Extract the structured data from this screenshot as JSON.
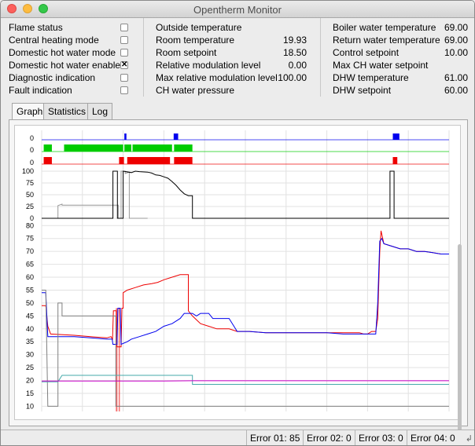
{
  "window": {
    "title": "Opentherm Monitor"
  },
  "status": {
    "flags": [
      {
        "label": "Flame status",
        "checked": false
      },
      {
        "label": "Central heating mode",
        "checked": false
      },
      {
        "label": "Domestic hot water mode",
        "checked": false
      },
      {
        "label": "Domestic hot water enable",
        "checked": true
      },
      {
        "label": "Diagnostic indication",
        "checked": false
      },
      {
        "label": "Fault indication",
        "checked": false
      }
    ],
    "middle": [
      {
        "label": "Outside temperature",
        "value": ""
      },
      {
        "label": "Room temperature",
        "value": "19.93"
      },
      {
        "label": "Room setpoint",
        "value": "18.50"
      },
      {
        "label": "Relative modulation level",
        "value": "0.00"
      },
      {
        "label": "Max relative modulation level",
        "value": "100.00"
      },
      {
        "label": "CH water pressure",
        "value": ""
      }
    ],
    "right": [
      {
        "label": "Boiler water temperature",
        "value": "69.00"
      },
      {
        "label": "Return water temperature",
        "value": "69.00"
      },
      {
        "label": "Control setpoint",
        "value": "10.00"
      },
      {
        "label": "Max CH water setpoint",
        "value": ""
      },
      {
        "label": "DHW temperature",
        "value": "61.00"
      },
      {
        "label": "DHW setpoint",
        "value": "60.00"
      }
    ]
  },
  "tabs": [
    {
      "label": "Graph",
      "active": true
    },
    {
      "label": "Statistics",
      "active": false
    },
    {
      "label": "Log",
      "active": false
    }
  ],
  "chart_data": {
    "type": "line",
    "x_range": [
      0,
      100
    ],
    "colors": {
      "flame": "#0000ee",
      "ch": "#00cc00",
      "dhw": "#ee0000",
      "modulation": "#000000",
      "boiler": "#ee0000",
      "return": "#0000ee",
      "control": "#808080",
      "room": "#cc00cc",
      "room_setpoint": "#44aaaa"
    },
    "digital": [
      {
        "name": "",
        "zero_label": "0",
        "color": "#0000ee",
        "pulses": [
          [
            20.3,
            20.8
          ],
          [
            32.4,
            33.5
          ],
          [
            86.2,
            87.8
          ]
        ]
      },
      {
        "name": "",
        "zero_label": "0",
        "color": "#00cc00",
        "pulses": [
          [
            0.5,
            2.5
          ],
          [
            5.5,
            20.0
          ],
          [
            20.3,
            22.0
          ],
          [
            22.3,
            32.0
          ],
          [
            32.5,
            37.0
          ]
        ]
      },
      {
        "name": "",
        "zero_label": "0",
        "color": "#ee0000",
        "pulses": [
          [
            0.5,
            2.5
          ],
          [
            19.0,
            20.2
          ],
          [
            21.0,
            31.5
          ],
          [
            32.5,
            37.0
          ],
          [
            86.2,
            87.3
          ]
        ]
      }
    ],
    "modulation": {
      "name": "",
      "y_ticks": [
        0,
        25,
        50,
        75,
        100
      ],
      "ylim": [
        0,
        100
      ],
      "grey": [
        [
          0,
          0
        ],
        [
          4,
          0
        ],
        [
          4,
          27
        ],
        [
          5,
          30
        ],
        [
          5,
          28
        ],
        [
          18.8,
          28
        ],
        [
          18.8,
          0
        ],
        [
          19.5,
          0
        ],
        [
          19.5,
          100
        ],
        [
          20.5,
          100
        ],
        [
          20.5,
          95
        ],
        [
          21.5,
          98
        ],
        [
          21.5,
          0
        ],
        [
          26,
          0
        ]
      ],
      "black": [
        [
          0,
          0
        ],
        [
          17.5,
          0
        ],
        [
          17.5,
          100
        ],
        [
          18.6,
          100
        ],
        [
          18.6,
          0
        ],
        [
          20.0,
          0
        ],
        [
          20.0,
          100
        ],
        [
          22,
          97
        ],
        [
          23,
          100
        ],
        [
          24,
          99
        ],
        [
          26,
          98
        ],
        [
          27,
          96
        ],
        [
          28,
          92
        ],
        [
          29,
          91
        ],
        [
          30,
          88
        ],
        [
          31,
          85
        ],
        [
          32,
          78
        ],
        [
          33,
          70
        ],
        [
          34,
          60
        ],
        [
          35,
          52
        ],
        [
          36,
          48
        ],
        [
          37,
          48
        ],
        [
          37,
          0
        ],
        [
          85.5,
          0
        ],
        [
          85.5,
          100
        ],
        [
          86.5,
          100
        ],
        [
          86.5,
          0
        ],
        [
          100,
          0
        ]
      ]
    },
    "temperatures": {
      "y_ticks": [
        10,
        15,
        20,
        25,
        30,
        35,
        40,
        45,
        50,
        55,
        60,
        65,
        70,
        75,
        80
      ],
      "ylim": [
        8,
        81
      ],
      "series": [
        {
          "name": "",
          "color": "#ee0000",
          "points": [
            [
              0,
              49
            ],
            [
              1,
              49
            ],
            [
              1.5,
              41
            ],
            [
              2.2,
              38
            ],
            [
              8,
              37.5
            ],
            [
              12,
              37
            ],
            [
              16,
              36.5
            ],
            [
              17,
              37
            ],
            [
              17.4,
              36
            ],
            [
              17.6,
              47
            ],
            [
              18.3,
              47
            ],
            [
              18.5,
              33
            ],
            [
              19.5,
              33
            ],
            [
              19.7,
              48
            ],
            [
              20,
              48
            ],
            [
              20,
              54
            ],
            [
              21,
              55
            ],
            [
              23,
              56
            ],
            [
              25,
              57
            ],
            [
              27,
              57.5
            ],
            [
              28.5,
              58
            ],
            [
              30,
              59
            ],
            [
              32,
              60
            ],
            [
              34,
              61
            ],
            [
              36,
              61
            ],
            [
              36,
              47
            ],
            [
              37,
              45
            ],
            [
              39,
              42
            ],
            [
              41,
              41
            ],
            [
              43,
              40
            ],
            [
              46,
              40
            ],
            [
              48,
              39
            ],
            [
              51,
              39
            ],
            [
              55,
              38.5
            ],
            [
              59,
              38.5
            ],
            [
              63,
              38.5
            ],
            [
              68,
              38.5
            ],
            [
              72,
              38.5
            ],
            [
              76,
              38.5
            ],
            [
              78,
              38.5
            ],
            [
              79,
              38
            ],
            [
              80,
              38
            ],
            [
              81,
              39
            ],
            [
              82,
              39
            ],
            [
              82.5,
              44
            ],
            [
              83,
              70
            ],
            [
              83.3,
              78
            ],
            [
              84,
              73
            ],
            [
              86,
              72
            ],
            [
              88,
              71
            ],
            [
              90,
              71
            ],
            [
              92,
              70
            ],
            [
              94,
              70
            ],
            [
              96,
              69.5
            ],
            [
              98,
              69
            ],
            [
              100,
              69
            ]
          ]
        },
        {
          "name": "",
          "color": "#0000ee",
          "points": [
            [
              0,
              54
            ],
            [
              1,
              54
            ],
            [
              1.5,
              37
            ],
            [
              2.2,
              37
            ],
            [
              8,
              37
            ],
            [
              12,
              36.5
            ],
            [
              16,
              36
            ],
            [
              17.3,
              36
            ],
            [
              17.5,
              34
            ],
            [
              18.5,
              34
            ],
            [
              18.7,
              48
            ],
            [
              19.3,
              48
            ],
            [
              19.5,
              34
            ],
            [
              21,
              35
            ],
            [
              22,
              36
            ],
            [
              24,
              37
            ],
            [
              26,
              38
            ],
            [
              28,
              39
            ],
            [
              30,
              41
            ],
            [
              32,
              42
            ],
            [
              34,
              44
            ],
            [
              35,
              46
            ],
            [
              37,
              46
            ],
            [
              38,
              45
            ],
            [
              39,
              46
            ],
            [
              41,
              46
            ],
            [
              42,
              44
            ],
            [
              46,
              44
            ],
            [
              48,
              39
            ],
            [
              51,
              39
            ],
            [
              55,
              38.5
            ],
            [
              60,
              38.5
            ],
            [
              65,
              38.5
            ],
            [
              70,
              38.5
            ],
            [
              74,
              38
            ],
            [
              79,
              38
            ],
            [
              82,
              38
            ],
            [
              82.5,
              50
            ],
            [
              83,
              74
            ],
            [
              83.5,
              75
            ],
            [
              84,
              73
            ],
            [
              86,
              72
            ],
            [
              88,
              71
            ],
            [
              90,
              71
            ],
            [
              92,
              70
            ],
            [
              94,
              70
            ],
            [
              96,
              69.5
            ],
            [
              98,
              69
            ],
            [
              100,
              69
            ]
          ]
        },
        {
          "name": "",
          "color": "#808080",
          "points": [
            [
              0,
              55
            ],
            [
              1,
              55
            ],
            [
              1.5,
              10
            ],
            [
              4,
              10
            ],
            [
              4,
              50
            ],
            [
              5,
              50
            ],
            [
              5,
              45
            ],
            [
              18.2,
              45
            ],
            [
              18.2,
              10
            ],
            [
              100,
              10
            ]
          ]
        },
        {
          "name": "",
          "color": "#44aaaa",
          "points": [
            [
              0,
              19.5
            ],
            [
              4,
              19.5
            ],
            [
              5,
              22
            ],
            [
              37,
              22
            ],
            [
              37,
              18.5
            ],
            [
              100,
              18.5
            ]
          ]
        },
        {
          "name": "",
          "color": "#cc00cc",
          "points": [
            [
              0,
              19.8
            ],
            [
              30,
              19.8
            ],
            [
              37,
              19.9
            ],
            [
              100,
              19.9
            ]
          ]
        }
      ],
      "spikes": [
        [
          18.2,
          18.6
        ],
        [
          18.9,
          19.2
        ]
      ]
    }
  },
  "statusbar": {
    "errors": [
      {
        "label": "Error 01:",
        "value": "85"
      },
      {
        "label": "Error 02:",
        "value": "0"
      },
      {
        "label": "Error 03:",
        "value": "0"
      },
      {
        "label": "Error 04:",
        "value": "0"
      }
    ]
  }
}
